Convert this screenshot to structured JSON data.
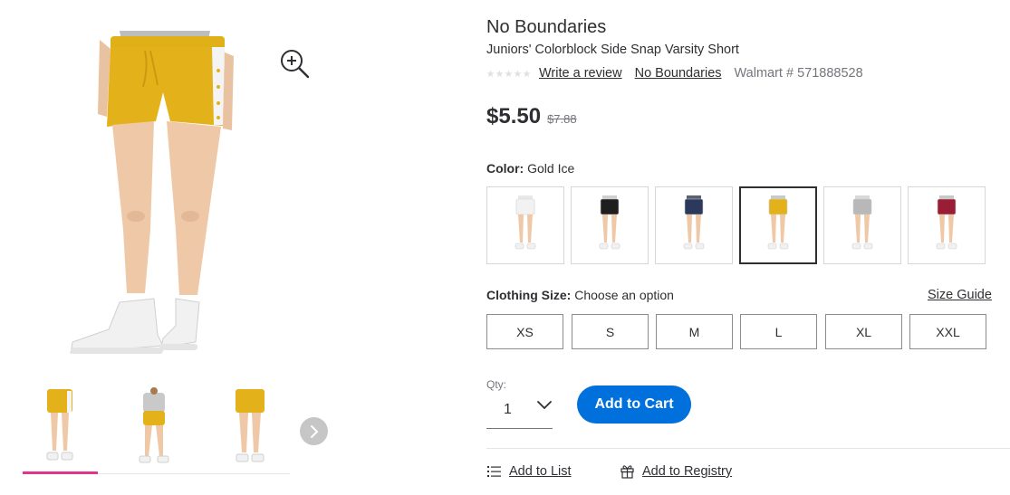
{
  "product": {
    "brand": "No Boundaries",
    "name": "Juniors' Colorblock Side Snap Varsity Short",
    "write_review": "Write a review",
    "brand_link": "No Boundaries",
    "walmart_number": "Walmart # 571888528",
    "price": "$5.50",
    "was_price": "$7.88"
  },
  "color": {
    "label": "Color:",
    "value": "Gold Ice",
    "swatches": [
      {
        "name": "white",
        "short_color": "#f2f2f2",
        "top_color": "#e8e8e8"
      },
      {
        "name": "black",
        "short_color": "#1e1e1e",
        "top_color": "#cfcfcf"
      },
      {
        "name": "navy",
        "short_color": "#2b3a5c",
        "top_color": "#5a6170"
      },
      {
        "name": "gold-ice",
        "short_color": "#e3b21a",
        "top_color": "#c9c9c9",
        "selected": true
      },
      {
        "name": "grey",
        "short_color": "#b8b8b8",
        "top_color": "#d9d9d9"
      },
      {
        "name": "burgundy",
        "short_color": "#9b1c35",
        "top_color": "#c8c8c8"
      }
    ]
  },
  "size": {
    "label": "Clothing Size:",
    "value": "Choose an option",
    "guide": "Size Guide",
    "options": [
      "XS",
      "S",
      "M",
      "L",
      "XL",
      "XXL"
    ]
  },
  "qty": {
    "label": "Qty:",
    "value": "1"
  },
  "actions": {
    "add_to_cart": "Add to Cart",
    "add_to_list": "Add to List",
    "add_to_registry": "Add to Registry"
  },
  "rating_stars": 5,
  "colors": {
    "accent": "#0071dc",
    "thumb_indicator": "#e3338d",
    "shorts": "#e3b21a"
  },
  "icons": {
    "zoom": "zoom-in-icon",
    "next": "chevron-right-icon",
    "qty": "chevron-down-icon",
    "list": "list-icon",
    "registry": "gift-icon"
  }
}
